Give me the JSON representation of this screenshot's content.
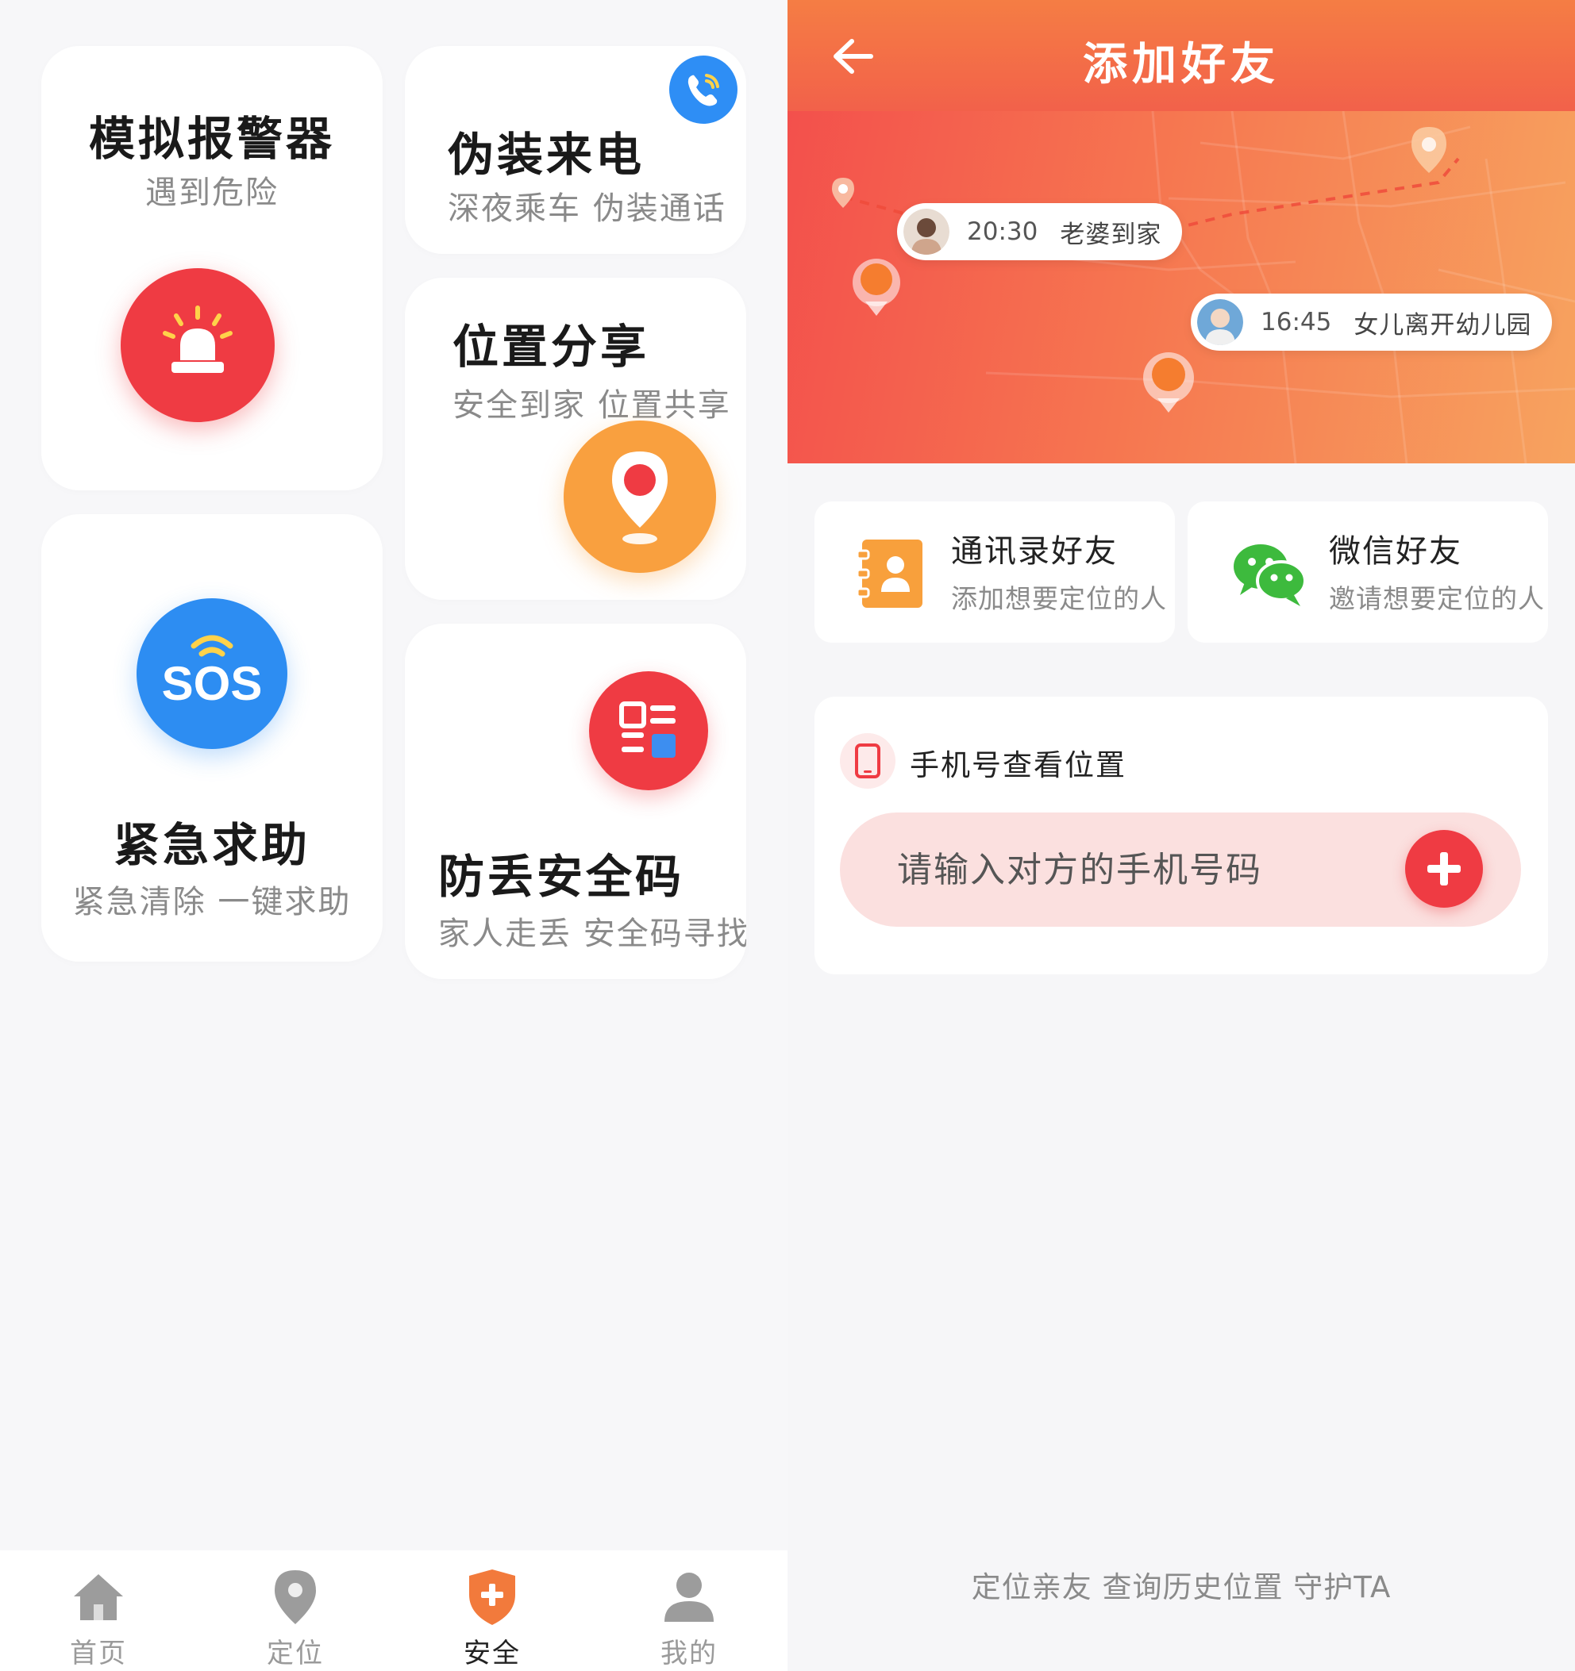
{
  "left_screen": {
    "cards": {
      "alarm": {
        "title": "模拟报警器",
        "subtitle": "遇到危险",
        "icon": "siren-icon"
      },
      "fake_call": {
        "title": "伪装来电",
        "subtitle": "深夜乘车  伪装通话",
        "icon": "phone-call-icon"
      },
      "location_share": {
        "title": "位置分享",
        "subtitle": "安全到家  位置共享",
        "icon": "location-pin-icon"
      },
      "sos": {
        "title": "紧急求助",
        "subtitle": "紧急清除  一键求助",
        "icon_text": "SOS"
      },
      "safety_code": {
        "title": "防丢安全码",
        "subtitle": "家人走丢  安全码寻找",
        "icon": "qr-code-icon"
      }
    },
    "bottom_nav": [
      {
        "label": "首页",
        "icon": "home-icon"
      },
      {
        "label": "定位",
        "icon": "location-icon"
      },
      {
        "label": "安全",
        "icon": "shield-plus-icon",
        "active": true
      },
      {
        "label": "我的",
        "icon": "profile-icon"
      }
    ]
  },
  "right_screen": {
    "header": {
      "title": "添加好友",
      "back_icon": "back-arrow-icon"
    },
    "map": {
      "tags": [
        {
          "time": "20:30",
          "event": "老婆到家"
        },
        {
          "time": "16:45",
          "event": "女儿离开幼儿园"
        }
      ]
    },
    "friend_options": [
      {
        "title": "通讯录好友",
        "subtitle": "添加想要定位的人",
        "icon": "contacts-book-icon"
      },
      {
        "title": "微信好友",
        "subtitle": "邀请想要定位的人",
        "icon": "wechat-icon"
      }
    ],
    "phone_lookup": {
      "title": "手机号查看位置",
      "placeholder": "请输入对方的手机号码",
      "add_icon": "plus-icon"
    },
    "slogan": "定位亲友  查询历史位置  守护TA"
  },
  "colors": {
    "accent_red": "#ef3b43",
    "accent_orange": "#f9a03f",
    "accent_blue": "#2d8df2",
    "header_gradient_top": "#f57d44",
    "header_gradient_bottom": "#f2614a",
    "wechat_green": "#3dba3d"
  }
}
